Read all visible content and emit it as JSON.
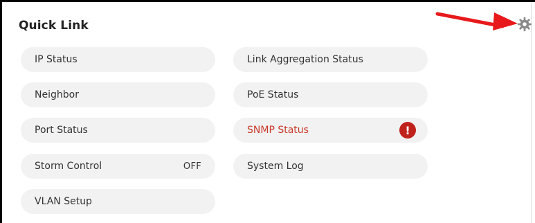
{
  "panel": {
    "title": "Quick Link"
  },
  "links": {
    "ip_status": "IP Status",
    "link_aggregation_status": "Link Aggregation Status",
    "neighbor": "Neighbor",
    "poe_status": "PoE Status",
    "port_status": "Port Status",
    "snmp_status": "SNMP Status",
    "storm_control": "Storm Control",
    "storm_control_state": "OFF",
    "system_log": "System Log",
    "vlan_setup": "VLAN Setup"
  },
  "badges": {
    "alert_glyph": "!"
  },
  "icons": {
    "settings": "gear-icon",
    "callout": "red-arrow-annotation"
  },
  "colors": {
    "pill_bg": "#f2f2f2",
    "warning_text": "#c8372a",
    "alert_badge": "#c0231c",
    "arrow": "#e8191b"
  }
}
